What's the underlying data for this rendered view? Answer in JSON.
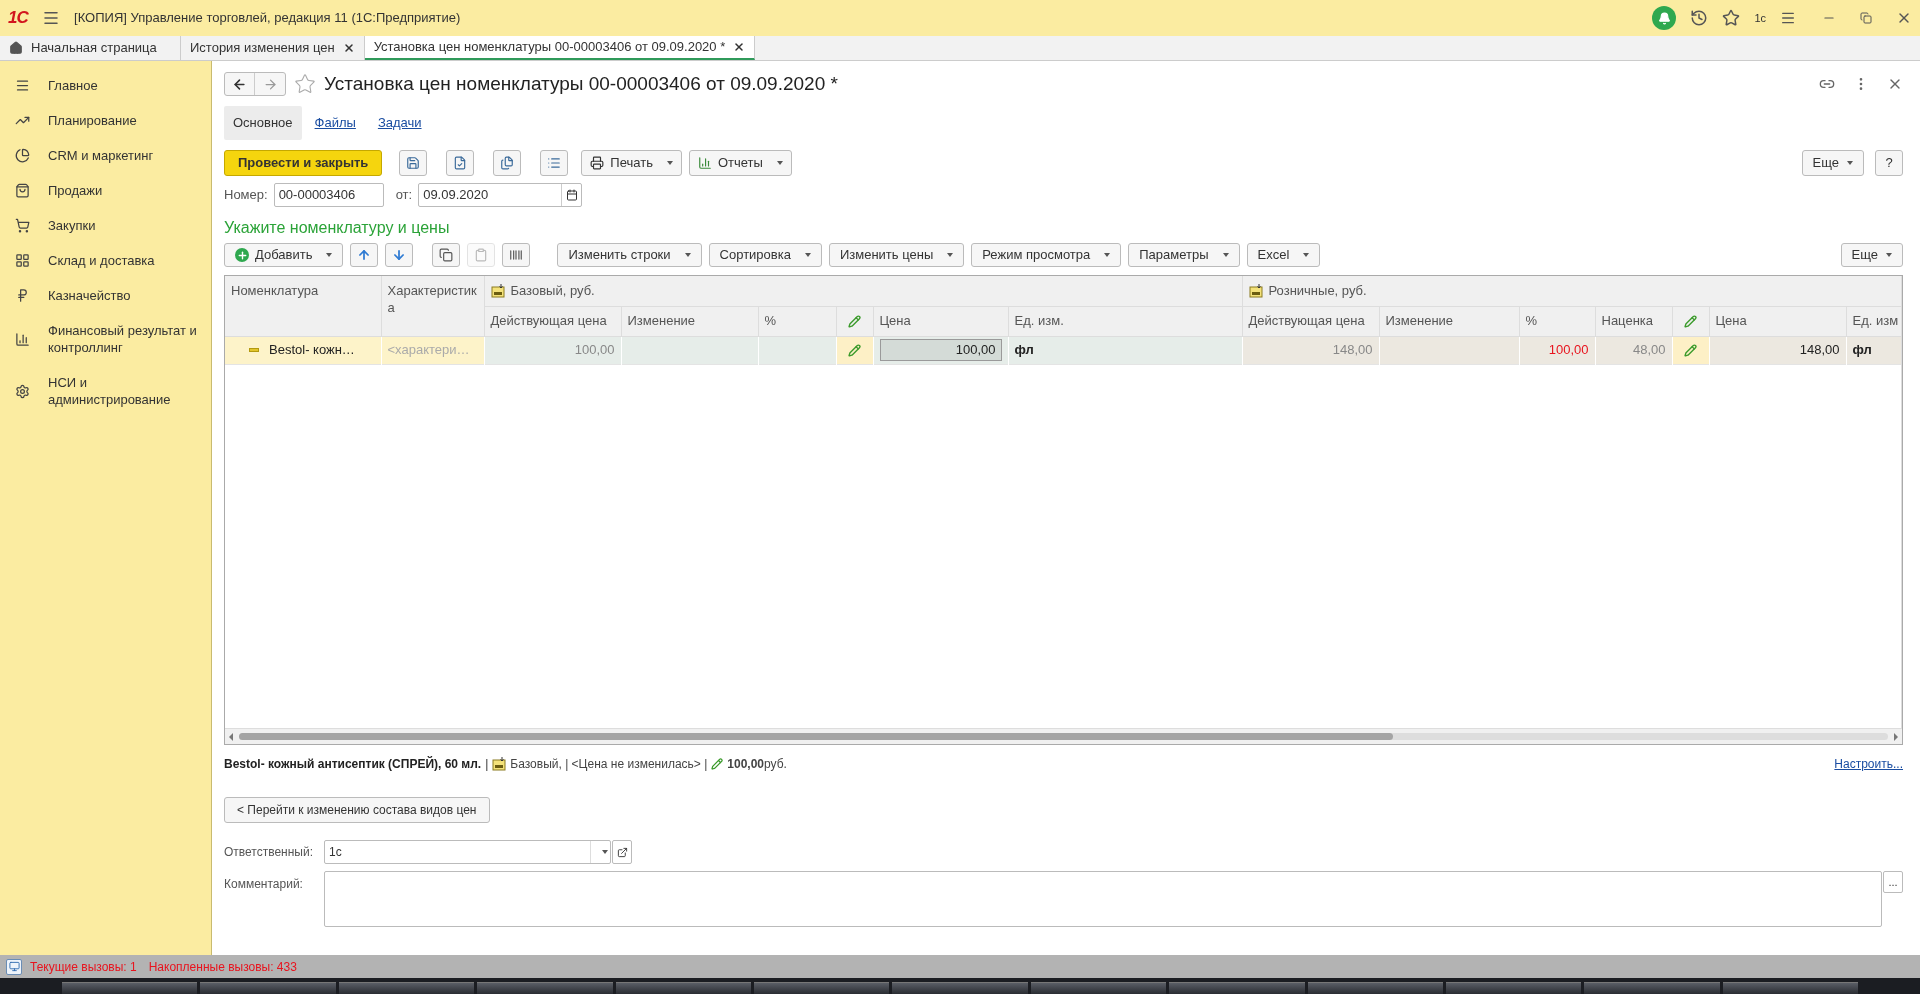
{
  "app_bar": {
    "logo": "1С",
    "title": "[КОПИЯ] Управление торговлей, редакция 11  (1С:Предприятие)",
    "user": "1с"
  },
  "open_tabs": [
    {
      "label": "Начальная страница",
      "kind": "home",
      "selected": false
    },
    {
      "label": "История изменения цен",
      "kind": "closable",
      "selected": false
    },
    {
      "label": "Установка цен номенклатуры 00-00003406 от 09.09.2020 *",
      "kind": "closable",
      "selected": true
    }
  ],
  "sidebar": {
    "items": [
      {
        "label": "Главное"
      },
      {
        "label": "Планирование"
      },
      {
        "label": "CRM и маркетинг"
      },
      {
        "label": "Продажи"
      },
      {
        "label": "Закупки"
      },
      {
        "label": "Склад и доставка"
      },
      {
        "label": "Казначейство"
      },
      {
        "label": "Финансовый результат и контроллинг"
      },
      {
        "label": "НСИ и администрирование"
      }
    ]
  },
  "form": {
    "title": "Установка цен номенклатуры 00-00003406 от 09.09.2020 *",
    "tabs": [
      {
        "label": "Основное",
        "selected": true
      },
      {
        "label": "Файлы",
        "selected": false
      },
      {
        "label": "Задачи",
        "selected": false
      }
    ],
    "toolbar": [
      {
        "kind": "primary",
        "label": "Провести и закрыть"
      },
      {
        "kind": "icon"
      },
      {
        "kind": "icon"
      },
      {
        "kind": "icon"
      },
      {
        "kind": "icon"
      },
      {
        "kind": "menu",
        "label": "Печать"
      },
      {
        "kind": "menu",
        "label": "Отчеты"
      }
    ],
    "more": "Еще",
    "help": "?",
    "number": {
      "label": "Номер:",
      "value": "00-00003406"
    },
    "date": {
      "label": "от:",
      "value": "09.09.2020"
    },
    "section_title": "Укажите номенклатуру и цены",
    "table_toolbar": [
      {
        "kind": "menu",
        "label": "Добавить"
      },
      {
        "kind": "icon",
        "disabled": false
      },
      {
        "kind": "icon",
        "disabled": false
      },
      {
        "kind": "icon",
        "disabled": false
      },
      {
        "kind": "icon",
        "disabled": true
      },
      {
        "kind": "icon",
        "disabled": false
      },
      {
        "kind": "menu",
        "label": "Изменить строки"
      },
      {
        "kind": "menu",
        "label": "Сортировка"
      },
      {
        "kind": "menu",
        "label": "Изменить цены"
      },
      {
        "kind": "menu",
        "label": "Режим просмотра"
      },
      {
        "kind": "menu",
        "label": "Параметры"
      },
      {
        "kind": "menu",
        "label": "Excel"
      }
    ],
    "table_more": "Еще",
    "table": {
      "fixed_columns": [
        {
          "label": "Номенклатура"
        },
        {
          "label": "Характеристика"
        }
      ],
      "groups": [
        {
          "title": "Базовый, руб.",
          "columns": [
            {
              "kind": "text",
              "label": "Действующая цена"
            },
            {
              "kind": "text",
              "label": "Изменение"
            },
            {
              "kind": "text",
              "label": "%"
            },
            {
              "kind": "pencil"
            },
            {
              "kind": "text",
              "label": "Цена"
            },
            {
              "kind": "text",
              "label": "Ед. изм."
            }
          ]
        },
        {
          "title": "Розничные, руб.",
          "columns": [
            {
              "kind": "text",
              "label": "Действующая цена"
            },
            {
              "kind": "text",
              "label": "Изменение"
            },
            {
              "kind": "text",
              "label": "%"
            },
            {
              "kind": "text",
              "label": "Наценка"
            },
            {
              "kind": "pencil"
            },
            {
              "kind": "text",
              "label": "Цена"
            },
            {
              "kind": "text",
              "label": "Ед. изм"
            }
          ]
        }
      ],
      "rows": [
        {
          "selected": true,
          "cells": [
            {
              "kind": "tree",
              "text": "Bestol- кожн…"
            },
            {
              "kind": "placeholder",
              "text": "<характери…"
            },
            {
              "kind": "readonly",
              "text": "100,00"
            },
            {
              "kind": "empty"
            },
            {
              "kind": "empty"
            },
            {
              "kind": "pencil"
            },
            {
              "kind": "input",
              "text": "100,00"
            },
            {
              "kind": "unit",
              "text": "фл"
            },
            {
              "kind": "readonly",
              "text": "148,00"
            },
            {
              "kind": "empty"
            },
            {
              "kind": "warning",
              "text": "100,00"
            },
            {
              "kind": "readonly",
              "text": "48,00"
            },
            {
              "kind": "pencil"
            },
            {
              "kind": "value",
              "text": "148,00"
            },
            {
              "kind": "unit",
              "text": "фл"
            }
          ]
        }
      ]
    },
    "info": {
      "name": "Bestol- кожный антисептик (СПРЕЙ), 60 мл.",
      "sep": "|",
      "price_type": "Базовый, | <Цена не изменилась> |",
      "amount": "**100,00**руб."
    },
    "configure_link": "Настроить...",
    "back_button": "< Перейти к изменению состава видов цен",
    "responsible": {
      "label": "Ответственный:",
      "value": "1с"
    },
    "comment": {
      "label": "Комментарий:",
      "button": "..."
    }
  },
  "status_bar": [
    "Текущие вызовы: 1",
    "Накопленные вызовы: 433"
  ]
}
